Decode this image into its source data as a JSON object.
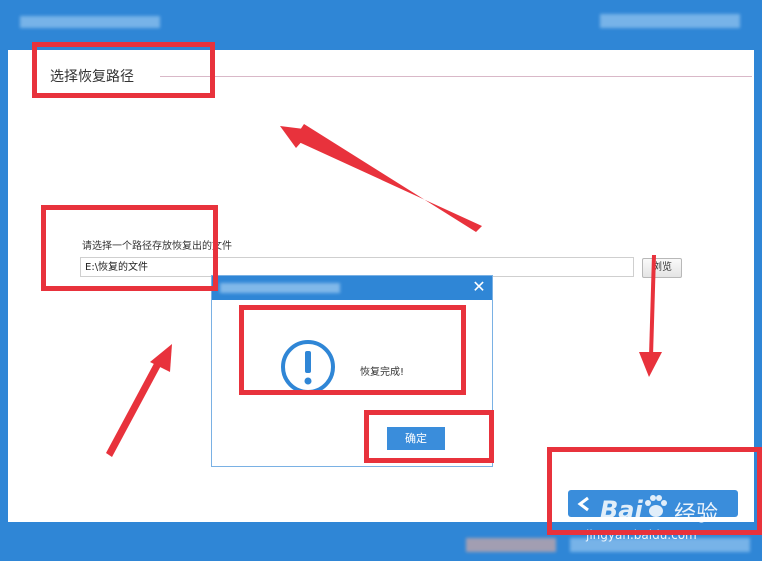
{
  "window": {
    "section_title": "选择恢复路径"
  },
  "path_section": {
    "prompt": "请选择一个路径存放恢复出的文件",
    "path_value": "E:\\恢复的文件",
    "browse_label": "浏览"
  },
  "dialog": {
    "close_symbol": "✕",
    "message": "恢复完成!",
    "ok_label": "确定"
  },
  "watermark": {
    "brand": "Bai",
    "suffix": "经验",
    "url": "jingyan.baidu.com"
  },
  "colors": {
    "accent": "#2f86d6",
    "annotation_red": "#e8323c"
  }
}
